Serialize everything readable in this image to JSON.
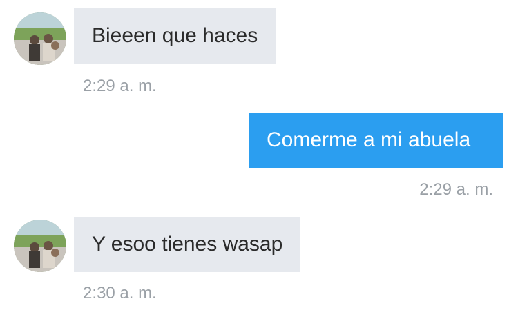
{
  "messages": [
    {
      "direction": "incoming",
      "text": "Bieeen que haces",
      "time": "2:29 a. m.",
      "avatar_icon": "contact-avatar-photo"
    },
    {
      "direction": "outgoing",
      "text": "Comerme a mi abuela",
      "time": "2:29 a. m."
    },
    {
      "direction": "incoming",
      "text": "Y esoo tienes wasap",
      "time": "2:30 a. m.",
      "avatar_icon": "contact-avatar-photo"
    }
  ],
  "colors": {
    "incoming_bubble": "#e6e9ee",
    "outgoing_bubble": "#2b9ef0",
    "timestamp": "#9aa0a6"
  }
}
